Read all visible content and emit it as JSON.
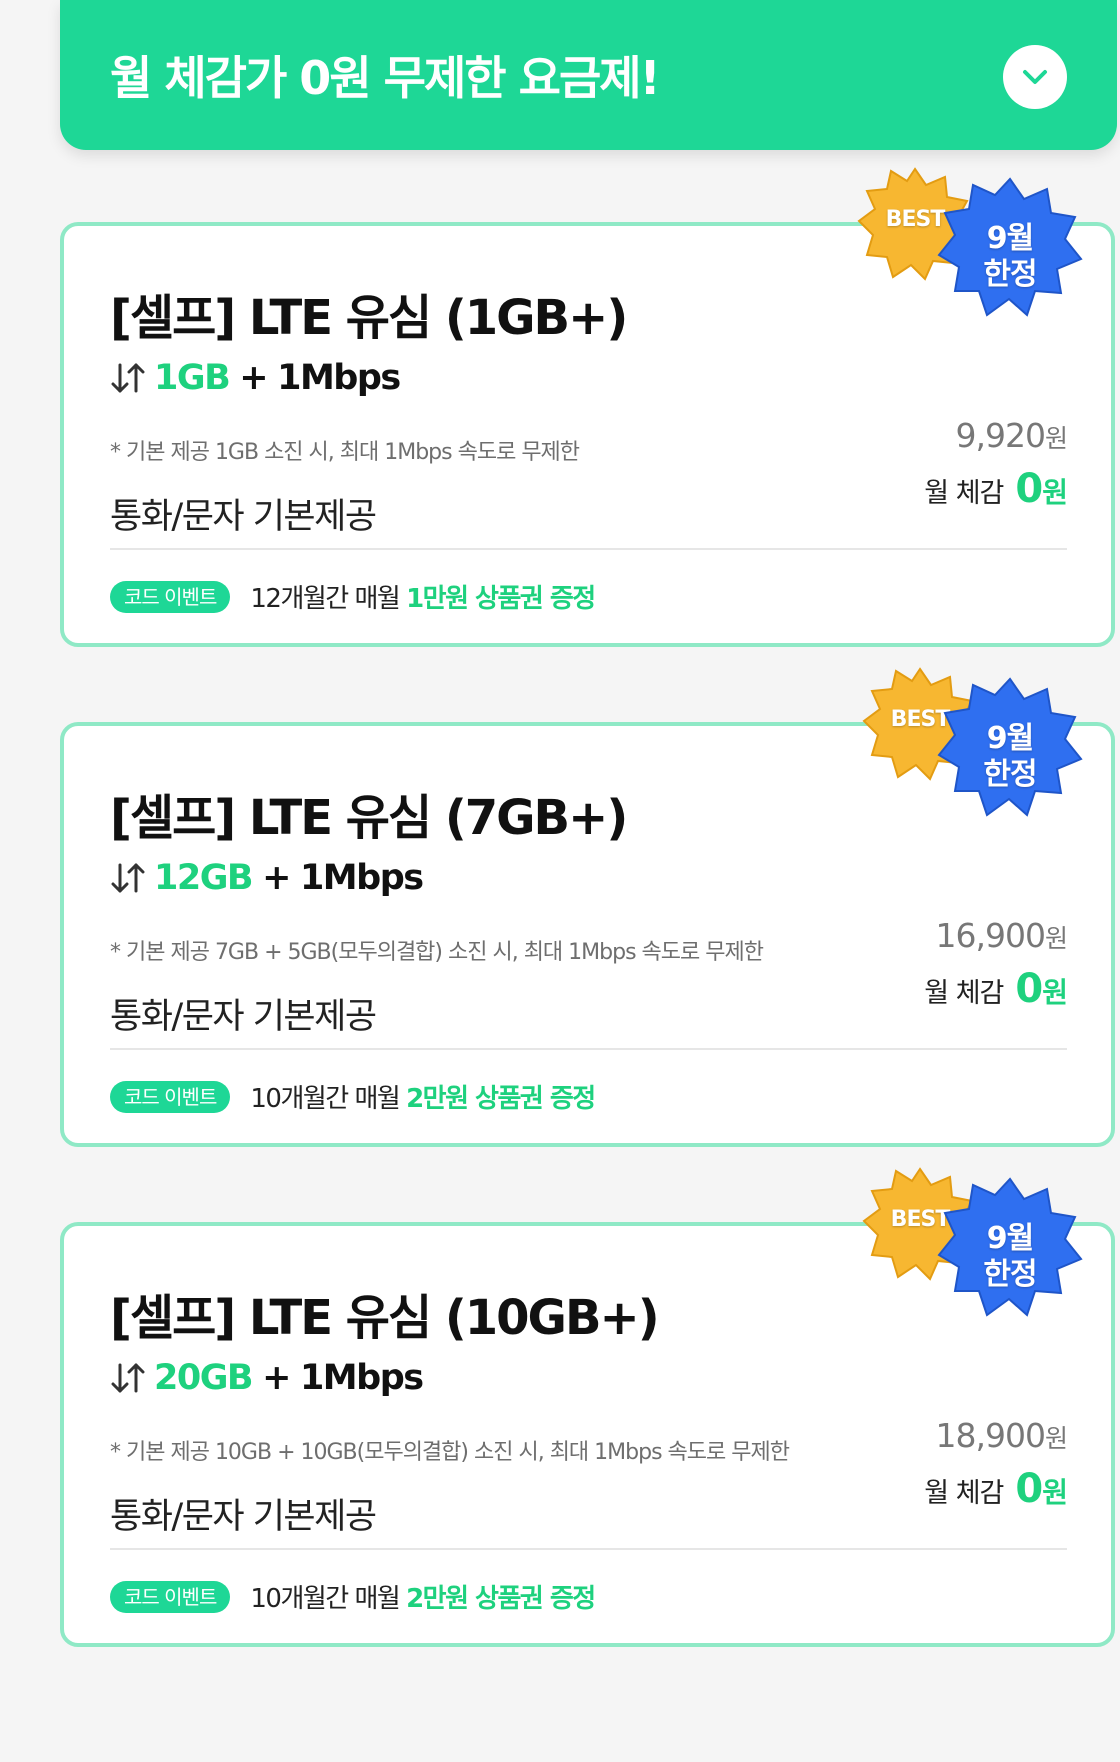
{
  "banner": {
    "title": "월 체감가 0원 무제한 요금제!",
    "toggle_icon": "chevron-down-icon"
  },
  "colors": {
    "accent": "#1ed796",
    "accent_text": "#1ed17e",
    "card_border": "#8fe9c6",
    "badge_best": "#f7b731",
    "badge_limited": "#2f6ff0"
  },
  "plans": [
    {
      "title": "[셀프] LTE 유심 (1GB+)",
      "data_icon": "arrows-updown-icon",
      "data_main": "1GB",
      "data_plus": "+",
      "data_speed": "1Mbps",
      "note": "* 기본 제공 1GB 소진 시, 최대 1Mbps 속도로 무제한",
      "call": "통화/문자 기본제공",
      "price": "9,920",
      "price_unit": "원",
      "monthly_label": "월 체감",
      "monthly_value": "0",
      "monthly_unit": "원",
      "event_badge": "코드 이벤트",
      "event_text": "12개월간 매월 ",
      "event_highlight": "1만원 상품권 증정",
      "badge_best": "BEST",
      "badge_limited_1": "9월",
      "badge_limited_2": "한정"
    },
    {
      "title": "[셀프] LTE 유심 (7GB+)",
      "data_icon": "arrows-updown-icon",
      "data_main": "12GB",
      "data_plus": "+",
      "data_speed": "1Mbps",
      "note": "* 기본 제공 7GB + 5GB(모두의결합) 소진 시, 최대 1Mbps 속도로 무제한",
      "call": "통화/문자 기본제공",
      "price": "16,900",
      "price_unit": "원",
      "monthly_label": "월 체감",
      "monthly_value": "0",
      "monthly_unit": "원",
      "event_badge": "코드 이벤트",
      "event_text": "10개월간 매월 ",
      "event_highlight": "2만원 상품권 증정",
      "badge_best": "BEST",
      "badge_limited_1": "9월",
      "badge_limited_2": "한정"
    },
    {
      "title": "[셀프] LTE 유심 (10GB+)",
      "data_icon": "arrows-updown-icon",
      "data_main": "20GB",
      "data_plus": "+",
      "data_speed": "1Mbps",
      "note": "* 기본 제공 10GB + 10GB(모두의결합) 소진 시, 최대 1Mbps 속도로 무제한",
      "call": "통화/문자 기본제공",
      "price": "18,900",
      "price_unit": "원",
      "monthly_label": "월 체감",
      "monthly_value": "0",
      "monthly_unit": "원",
      "event_badge": "코드 이벤트",
      "event_text": "10개월간 매월 ",
      "event_highlight": "2만원 상품권 증정",
      "badge_best": "BEST",
      "badge_limited_1": "9월",
      "badge_limited_2": "한정"
    }
  ]
}
